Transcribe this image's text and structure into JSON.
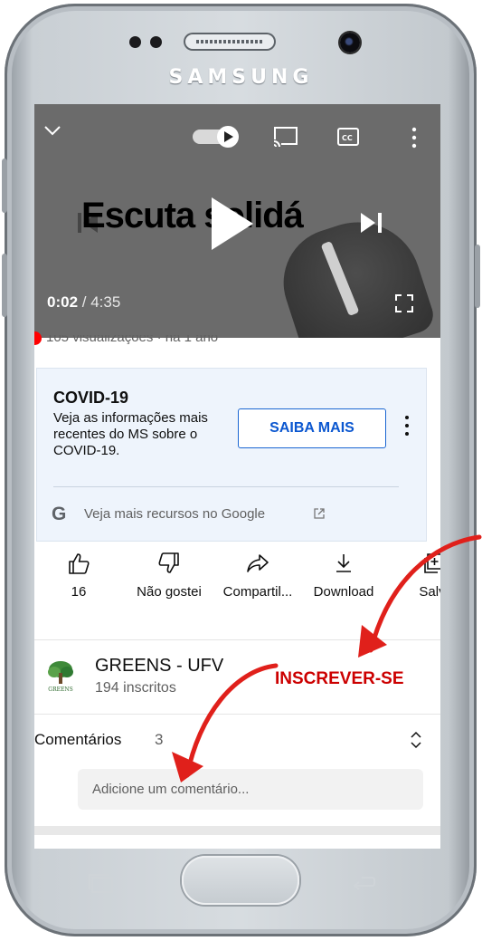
{
  "device": {
    "brand": "SAMSUNG"
  },
  "video": {
    "title_overlay": "Escuta solidá",
    "current_time": "0:02",
    "duration": "/ 4:35",
    "views_line": "105 visualizações · há 1 ano"
  },
  "covid_card": {
    "title": "COVID-19",
    "description": "Veja as informações mais recentes do MS sobre o COVID-19.",
    "button": "SAIBA MAIS",
    "google_letter": "G",
    "google_link": "Veja mais recursos no Google"
  },
  "actions": [
    {
      "icon": "thumbs-up-icon",
      "label": "16"
    },
    {
      "icon": "thumbs-down-icon",
      "label": "Não gostei"
    },
    {
      "icon": "share-icon",
      "label": "Compartil..."
    },
    {
      "icon": "download-icon",
      "label": "Download"
    },
    {
      "icon": "save-icon",
      "label": "Salv"
    }
  ],
  "channel": {
    "name": "GREENS - UFV",
    "subscribers": "194 inscritos",
    "subscribe_label": "INSCREVER-SE",
    "avatar_text": "GREENS"
  },
  "comments": {
    "title": "Comentários",
    "count": "3",
    "placeholder": "Adicione um comentário..."
  },
  "colors": {
    "annotation_arrow": "#e0201b",
    "subscribe": "#cc0000",
    "link_blue": "#0b57d0"
  }
}
